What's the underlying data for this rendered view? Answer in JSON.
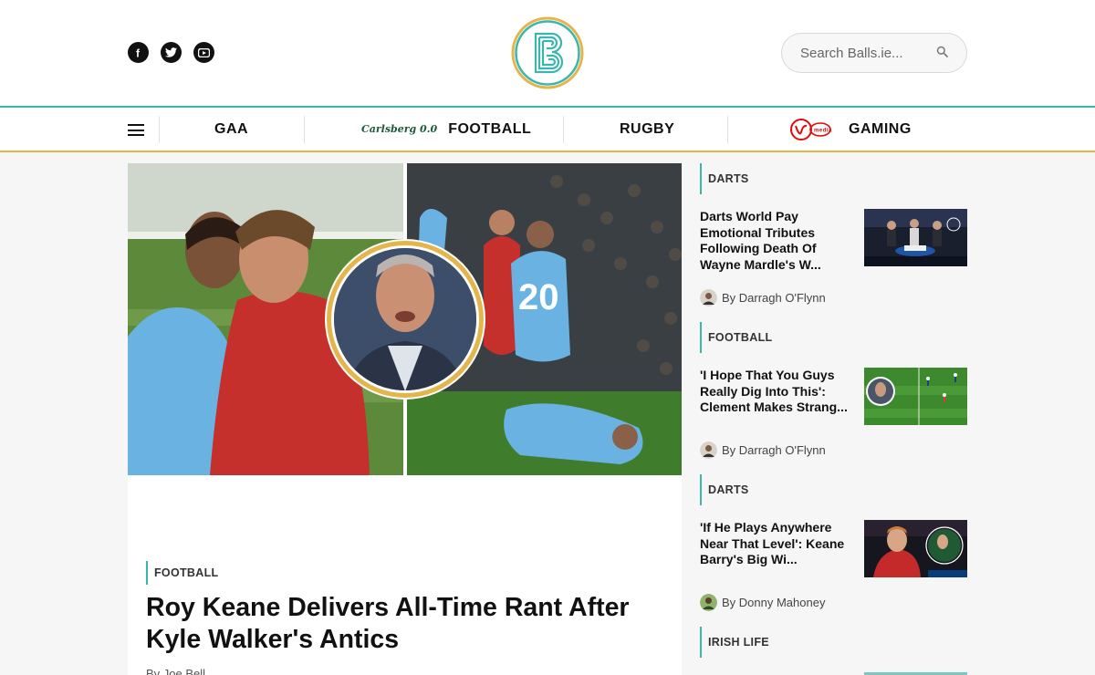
{
  "header": {
    "social": [
      {
        "name": "facebook",
        "glyph": "f"
      },
      {
        "name": "twitter",
        "glyph": ""
      },
      {
        "name": "youtube",
        "glyph": ""
      }
    ],
    "search_placeholder": "Search Balls.ie..."
  },
  "nav": {
    "items": [
      {
        "label": "GAA"
      },
      {
        "label": "FOOTBALL",
        "sponsor": "Carlsberg 0.0"
      },
      {
        "label": "RUGBY"
      },
      {
        "label": "GAMING",
        "sponsor": "Virgin Media"
      }
    ]
  },
  "hero": {
    "category": "FOOTBALL",
    "title": "Roy Keane Delivers All-Time Rant After Kyle Walker's Antics",
    "author": "By Joe Bell"
  },
  "sidebar": {
    "items": [
      {
        "category": "DARTS",
        "title": "Darts World Pay Emotional Tributes Following Death Of Wayne Mardle's W...",
        "author": "By Darragh O'Flynn"
      },
      {
        "category": "FOOTBALL",
        "title": "'I Hope That You Guys Really Dig Into This': Clement Makes Strang...",
        "author": "By Darragh O'Flynn"
      },
      {
        "category": "DARTS",
        "title": "'If He Plays Anywhere Near That Level': Keane Barry's Big Wi...",
        "author": "By Donny Mahoney"
      },
      {
        "category": "IRISH LIFE"
      }
    ]
  },
  "colors": {
    "teal": "#3bb6ad",
    "gold": "#e3b54b",
    "text": "#111111"
  }
}
